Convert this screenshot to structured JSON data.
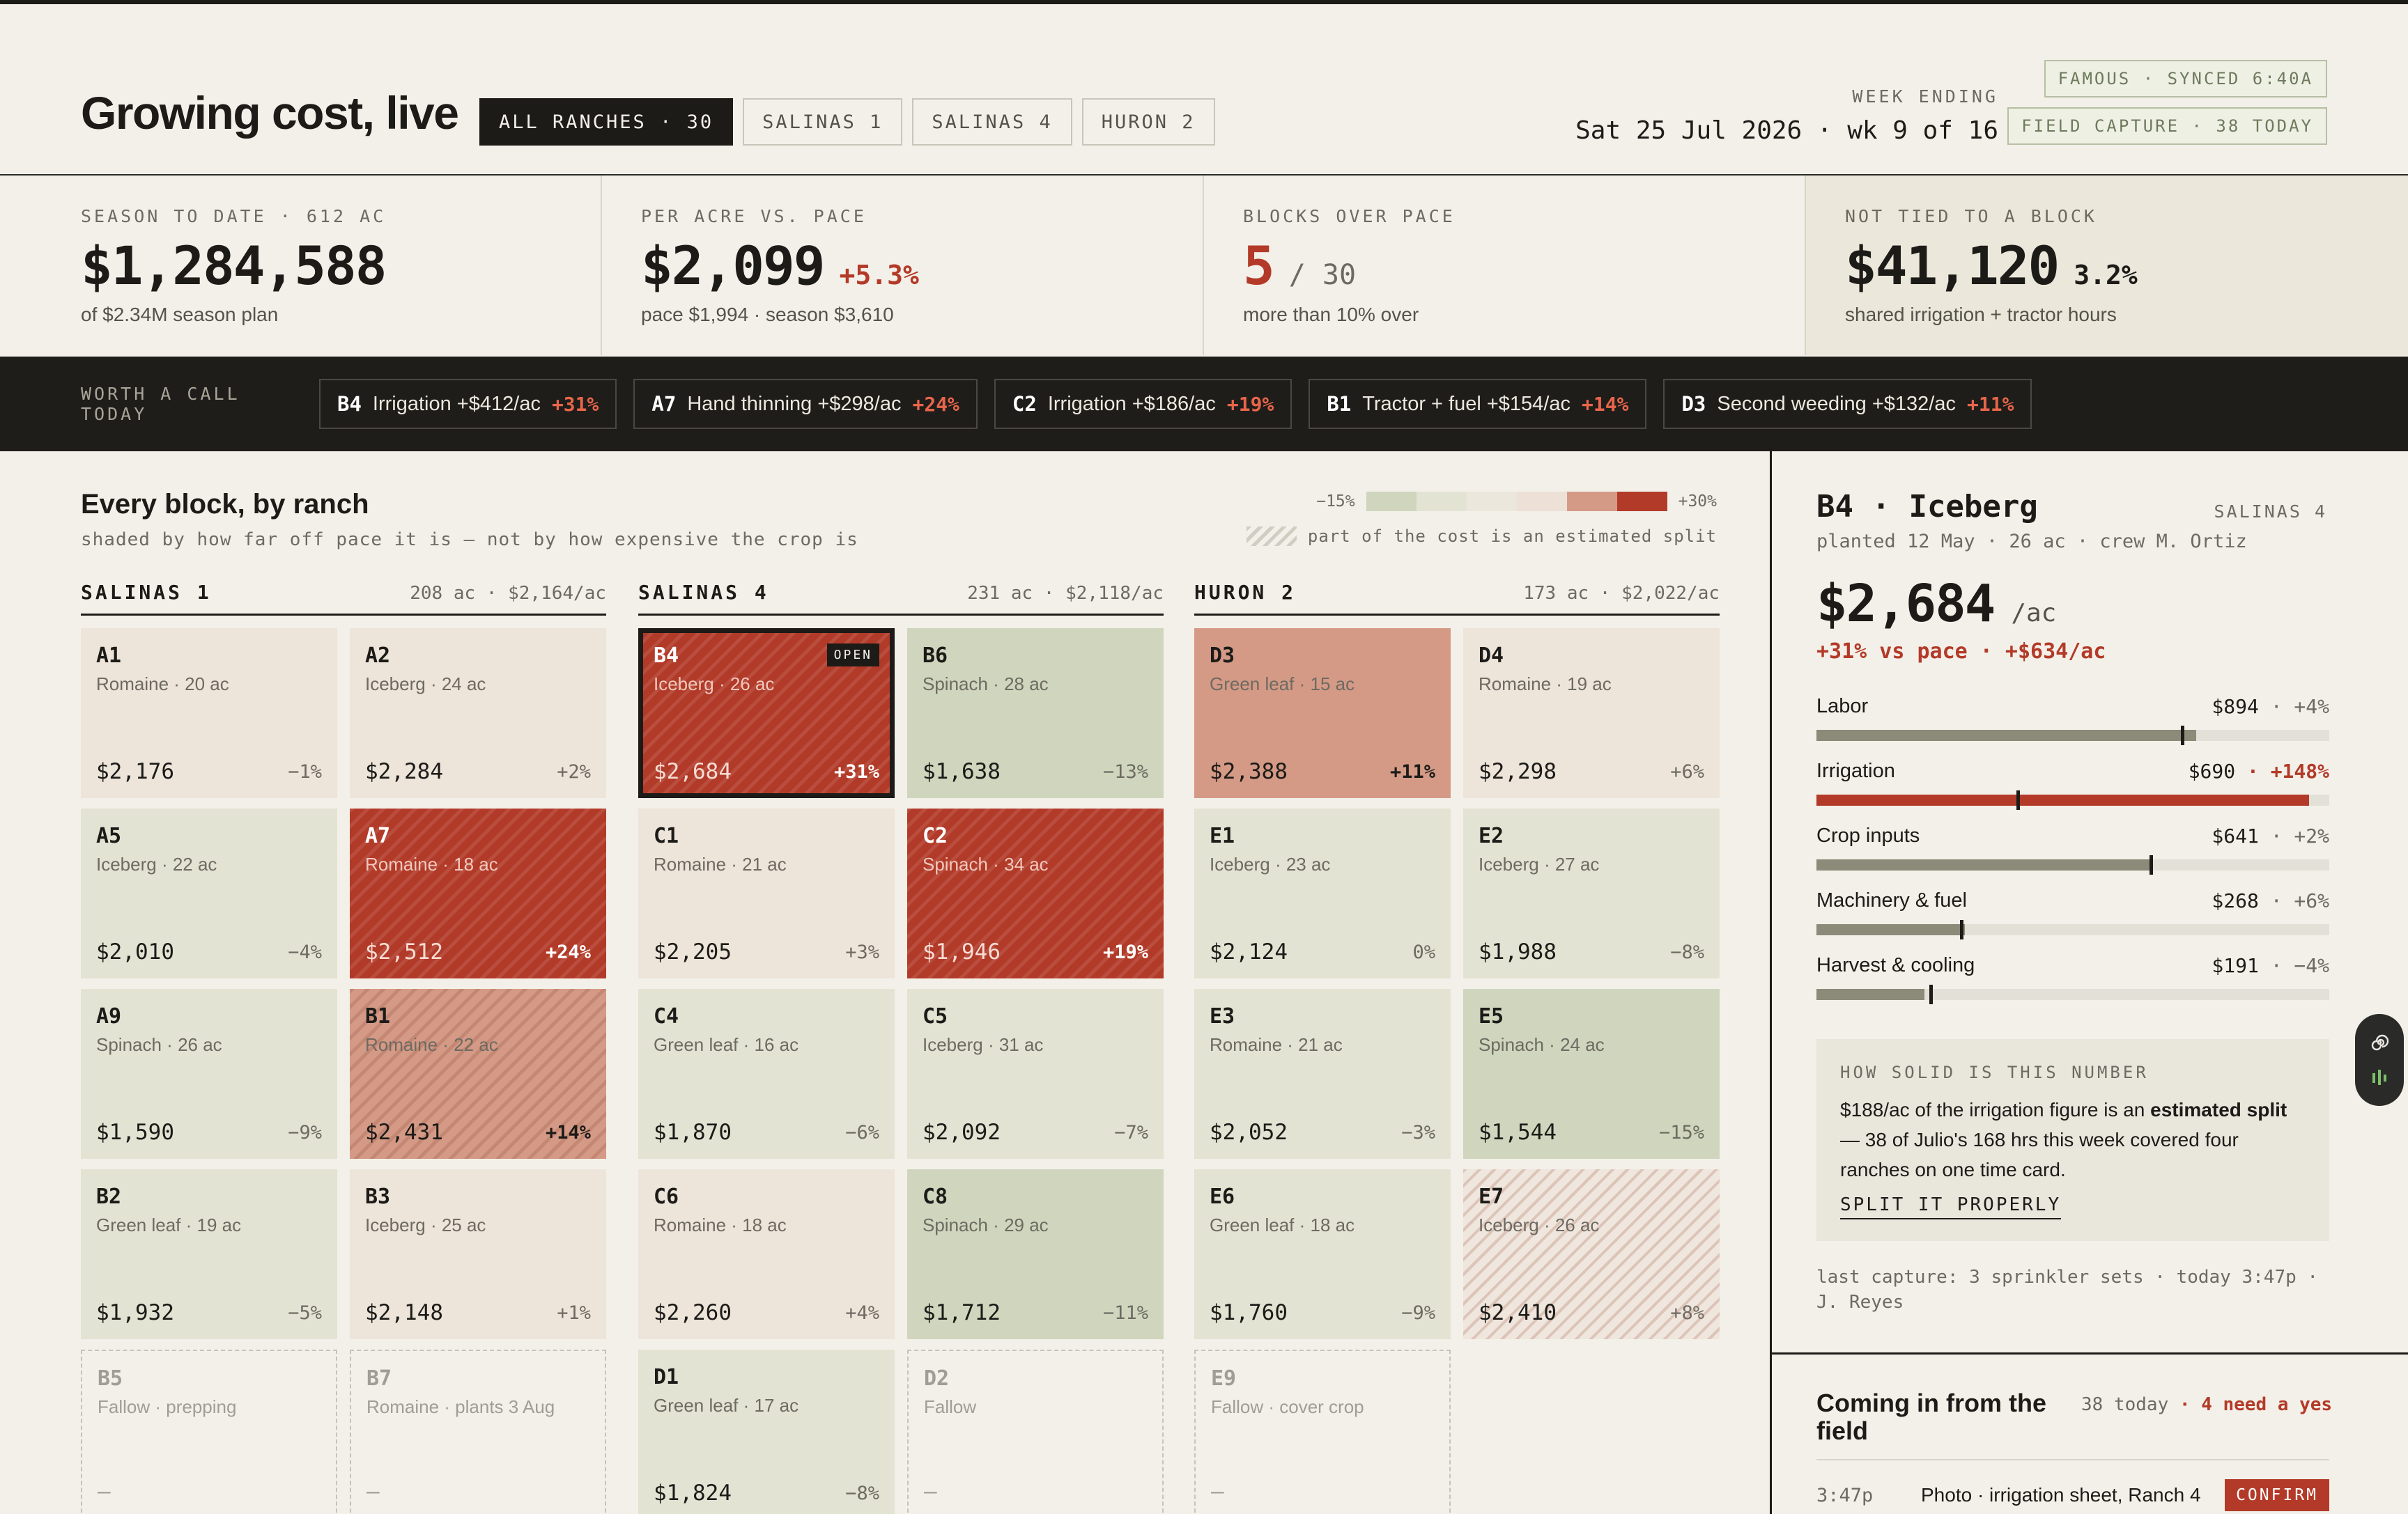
{
  "header": {
    "title": "Growing cost, live",
    "tabs": [
      {
        "label": "ALL RANCHES · 30",
        "active": true
      },
      {
        "label": "SALINAS 1"
      },
      {
        "label": "SALINAS 4"
      },
      {
        "label": "HURON 2"
      }
    ],
    "week_label": "WEEK ENDING",
    "week_value": "Sat 25 Jul 2026 · wk 9 of 16",
    "sync_status": "FAMOUS · SYNCED 6:40A",
    "field_capture": "FIELD CAPTURE · 38 TODAY"
  },
  "kpis": {
    "season": {
      "label": "SEASON TO DATE · 612 AC",
      "value": "$1,284,588",
      "sub": "of $2.34M season plan"
    },
    "per_acre": {
      "label": "PER ACRE VS. PACE",
      "value": "$2,099",
      "delta": "+5.3%",
      "sub": "pace $1,994 · season $3,610"
    },
    "over_pace": {
      "label": "BLOCKS OVER PACE",
      "value": "5",
      "of": "/ 30",
      "sub": "more than 10% over"
    },
    "untied": {
      "label": "NOT TIED TO A BLOCK",
      "value": "$41,120",
      "delta": "3.2%",
      "sub": "shared irrigation + tractor hours"
    }
  },
  "callbar": {
    "label": "WORTH A CALL TODAY",
    "items": [
      {
        "id": "B4",
        "text": "Irrigation +$412/ac",
        "pct": "+31%"
      },
      {
        "id": "A7",
        "text": "Hand thinning +$298/ac",
        "pct": "+24%"
      },
      {
        "id": "C2",
        "text": "Irrigation +$186/ac",
        "pct": "+19%"
      },
      {
        "id": "B1",
        "text": "Tractor + fuel +$154/ac",
        "pct": "+14%"
      },
      {
        "id": "D3",
        "text": "Second weeding +$132/ac",
        "pct": "+11%"
      }
    ]
  },
  "blocks": {
    "title": "Every block, by ranch",
    "subtitle": "shaded by how far off pace it is — not by how expensive the crop is",
    "legend_min": "−15%",
    "legend_max": "+30%",
    "legend_colors": [
      "#cfd6bd",
      "#e3e3d3",
      "#ece7dc",
      "#ede0d6",
      "#d49a86",
      "#b23a28"
    ],
    "hatch_note": "part of the cost is an estimated split",
    "ranches": [
      {
        "name": "SALINAS 1",
        "stats": "208 ac · $2,164/ac",
        "cells": [
          {
            "id": "A1",
            "crop": "Romaine · 20 ac",
            "cost": "$2,176",
            "pct": "−1%",
            "lv": "lv-3"
          },
          {
            "id": "A2",
            "crop": "Iceberg · 24 ac",
            "cost": "$2,284",
            "pct": "+2%",
            "lv": "lv-3"
          },
          {
            "id": "A5",
            "crop": "Iceberg · 22 ac",
            "cost": "$2,010",
            "pct": "−4%",
            "lv": "lv-2"
          },
          {
            "id": "A7",
            "crop": "Romaine · 18 ac",
            "cost": "$2,512",
            "pct": "+24%",
            "lv": "lv-5 hatch-red"
          },
          {
            "id": "A9",
            "crop": "Spinach · 26 ac",
            "cost": "$1,590",
            "pct": "−9%",
            "lv": "lv-2"
          },
          {
            "id": "B1",
            "crop": "Romaine · 22 ac",
            "cost": "$2,431",
            "pct": "+14%",
            "lv": "lv-4h hatch-pink"
          },
          {
            "id": "B2",
            "crop": "Green leaf · 19 ac",
            "cost": "$1,932",
            "pct": "−5%",
            "lv": "lv-2"
          },
          {
            "id": "B3",
            "crop": "Iceberg · 25 ac",
            "cost": "$2,148",
            "pct": "+1%",
            "lv": "lv-3"
          },
          {
            "id": "B5",
            "crop": "Fallow · prepping",
            "cost": "—",
            "pct": "",
            "lv": "fallow"
          },
          {
            "id": "B7",
            "crop": "Romaine · plants 3 Aug",
            "cost": "—",
            "pct": "",
            "lv": "fallow"
          }
        ]
      },
      {
        "name": "SALINAS 4",
        "stats": "231 ac · $2,118/ac",
        "cells": [
          {
            "id": "B4",
            "crop": "Iceberg · 26 ac",
            "cost": "$2,684",
            "pct": "+31%",
            "lv": "lv-5 hatch-red selected",
            "badge": "OPEN"
          },
          {
            "id": "B6",
            "crop": "Spinach · 28 ac",
            "cost": "$1,638",
            "pct": "−13%",
            "lv": "lv-1"
          },
          {
            "id": "C1",
            "crop": "Romaine · 21 ac",
            "cost": "$2,205",
            "pct": "+3%",
            "lv": "lv-3"
          },
          {
            "id": "C2",
            "crop": "Spinach · 34 ac",
            "cost": "$1,946",
            "pct": "+19%",
            "lv": "lv-5 hatch-red"
          },
          {
            "id": "C4",
            "crop": "Green leaf · 16 ac",
            "cost": "$1,870",
            "pct": "−6%",
            "lv": "lv-2"
          },
          {
            "id": "C5",
            "crop": "Iceberg · 31 ac",
            "cost": "$2,092",
            "pct": "−7%",
            "lv": "lv-2"
          },
          {
            "id": "C6",
            "crop": "Romaine · 18 ac",
            "cost": "$2,260",
            "pct": "+4%",
            "lv": "lv-3"
          },
          {
            "id": "C8",
            "crop": "Spinach · 29 ac",
            "cost": "$1,712",
            "pct": "−11%",
            "lv": "lv-1"
          },
          {
            "id": "D1",
            "crop": "Green leaf · 17 ac",
            "cost": "$1,824",
            "pct": "−8%",
            "lv": "lv-2"
          },
          {
            "id": "D2",
            "crop": "Fallow",
            "cost": "—",
            "pct": "",
            "lv": "fallow"
          }
        ]
      },
      {
        "name": "HURON 2",
        "stats": "173 ac · $2,022/ac",
        "cells": [
          {
            "id": "D3",
            "crop": "Green leaf · 15 ac",
            "cost": "$2,388",
            "pct": "+11%",
            "lv": "lv-4"
          },
          {
            "id": "D4",
            "crop": "Romaine · 19 ac",
            "cost": "$2,298",
            "pct": "+6%",
            "lv": "lv-3"
          },
          {
            "id": "E1",
            "crop": "Iceberg · 23 ac",
            "cost": "$2,124",
            "pct": "0%",
            "lv": "lv-2"
          },
          {
            "id": "E2",
            "crop": "Iceberg · 27 ac",
            "cost": "$1,988",
            "pct": "−8%",
            "lv": "lv-2"
          },
          {
            "id": "E3",
            "crop": "Romaine · 21 ac",
            "cost": "$2,052",
            "pct": "−3%",
            "lv": "lv-2"
          },
          {
            "id": "E5",
            "crop": "Spinach · 24 ac",
            "cost": "$1,544",
            "pct": "−15%",
            "lv": "lv-1"
          },
          {
            "id": "E6",
            "crop": "Green leaf · 18 ac",
            "cost": "$1,760",
            "pct": "−9%",
            "lv": "lv-2"
          },
          {
            "id": "E7",
            "crop": "Iceberg · 26 ac",
            "cost": "$2,410",
            "pct": "+8%",
            "lv": "hatch-lt"
          },
          {
            "id": "E9",
            "crop": "Fallow · cover crop",
            "cost": "—",
            "pct": "",
            "lv": "fallow"
          }
        ]
      }
    ]
  },
  "panel": {
    "title": "B4 · Iceberg",
    "ranch": "SALINAS 4",
    "meta": "planted 12 May · 26 ac · crew M. Ortiz",
    "cost": "$2,684",
    "unit": "/ac",
    "delta": "+31% vs pace · +$634/ac",
    "breakdown": [
      {
        "name": "Labor",
        "value": "$894",
        "pct": "· +4%",
        "fill": 0.74,
        "pace": 0.71
      },
      {
        "name": "Irrigation",
        "value": "$690",
        "pct": "· +148%",
        "red": true,
        "fill": 0.96,
        "pace": 0.39
      },
      {
        "name": "Crop inputs",
        "value": "$641",
        "pct": "· +2%",
        "fill": 0.65,
        "pace": 0.65
      },
      {
        "name": "Machinery & fuel",
        "value": "$268",
        "pct": "· +6%",
        "fill": 0.29,
        "pace": 0.28
      },
      {
        "name": "Harvest & cooling",
        "value": "$191",
        "pct": "· −4%",
        "fill": 0.21,
        "pace": 0.22
      }
    ],
    "solid_label": "HOW SOLID IS THIS NUMBER",
    "solid_pre": "$188/ac of the irrigation figure is an ",
    "solid_bold": "estimated split",
    "solid_post": " — 38 of Julio's 168 hrs this week covered four ranches on one time card.",
    "split_link": "SPLIT IT PROPERLY",
    "last_capture": "last capture: 3 sprinkler sets · today 3:47p · J. Reyes",
    "field_title": "Coming in from the field",
    "field_count": "38 today",
    "field_need": "· 4 need a yes",
    "field_rows": [
      {
        "time": "3:47p",
        "desc": "Photo · irrigation sheet, Ranch 4",
        "action": "CONFIRM"
      }
    ]
  }
}
